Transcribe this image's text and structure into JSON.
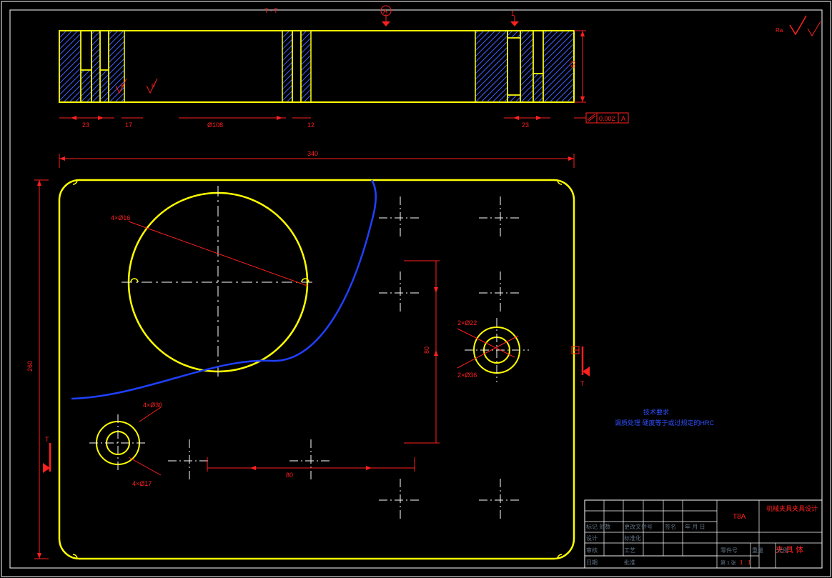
{
  "drawing": {
    "section_label": "T - T",
    "datum_A": "A",
    "datum_B": "1",
    "tolerance_box": "0.002",
    "tolerance_datum": "A",
    "surface_finish_right": "Ra",
    "section_mark_left": "T",
    "section_mark_right": "T"
  },
  "dims": {
    "top_width": "340",
    "left_height": "260",
    "thickness": "63",
    "hole_dia_large": "Ø108",
    "hole_small_23a": "23",
    "hole_small_23b": "23",
    "hole_12a": "12",
    "hole_17": "17",
    "circles_4x": "4×Ø16",
    "bolt_30": "4×Ø30",
    "bolt_17": "4×Ø17",
    "ring_22": "2×Ø22",
    "ring_36": "2×Ø36",
    "span_80": "80",
    "span_80b": "80"
  },
  "notes": {
    "n1": "技术要求",
    "n2": "调质处理 硬度等于或过规定的HRC"
  },
  "titleblock": {
    "material": "T8A",
    "title": "机械夹具夹具设计",
    "part": "夹 具 体",
    "scale": "1 : 1",
    "scale_label": "比例",
    "weight_label": "重量",
    "modeled": "零件号",
    "sheet": "第 1 张",
    "r1c1": "设计",
    "r1c2": "标准化",
    "r2c1": "审核",
    "r2c2": "工艺",
    "r3c1": "日期",
    "r3c2": "批准",
    "checked": "标记 处数",
    "date": "更改文件号",
    "sign": "签名",
    "year": "年 月 日"
  }
}
